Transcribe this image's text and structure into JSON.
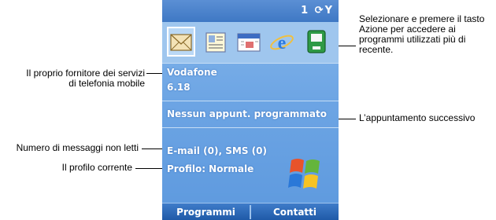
{
  "status": {
    "text": "1 ⟳Y"
  },
  "apps": [
    {
      "icon": "envelope-icon",
      "selected": true
    },
    {
      "icon": "contacts-card-icon",
      "selected": false
    },
    {
      "icon": "calendar-icon",
      "selected": false
    },
    {
      "icon": "internet-explorer-icon",
      "selected": false
    },
    {
      "icon": "phone-icon",
      "selected": false
    }
  ],
  "home": {
    "operator": "Vodafone",
    "time": "6.18",
    "appointment": "Nessun appunt. programmato",
    "messages": "E-mail (0), SMS (0)",
    "profile": "Profilo: Normale"
  },
  "softkeys": {
    "left": "Programmi",
    "right": "Contatti"
  },
  "callouts": {
    "operator": "Il proprio fornitore dei servizi\ndi telefonia mobile",
    "unread": "Numero di messaggi non letti",
    "profile": "Il profilo corrente",
    "recent_programs": "Selezionare e premere il tasto\nAzione per accedere ai\nprogrammi utilizzati più di\nrecente.",
    "next_appointment": "L’appuntamento successivo"
  },
  "colors": {
    "screen_background": "#6da5e4",
    "softkey_bar": "#1f5aa8",
    "text": "#ffffff"
  }
}
